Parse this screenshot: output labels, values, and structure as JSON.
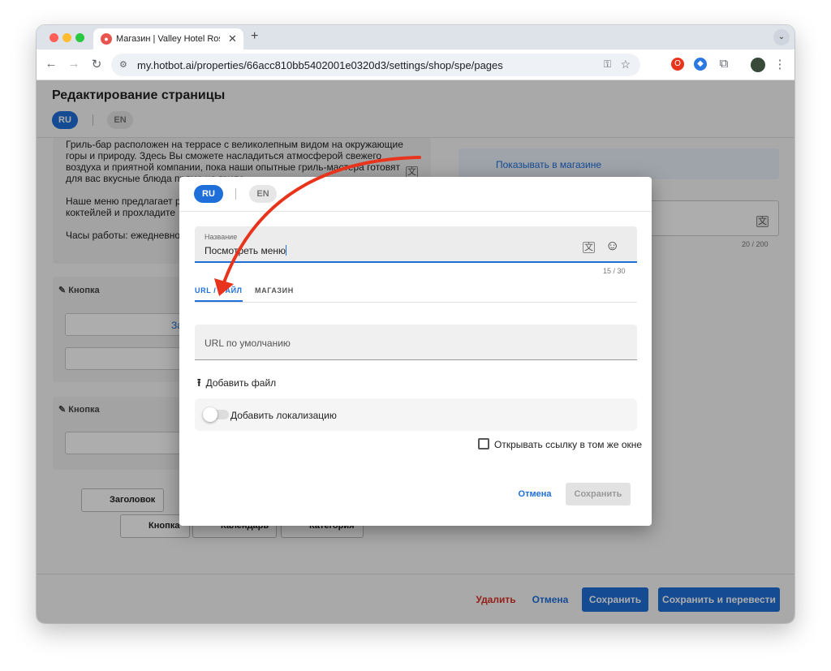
{
  "browser": {
    "tab_title": "Магазин | Valley Hotel Rosa Khutor",
    "tab_close": "✕",
    "new_tab": "+",
    "url": "my.hotbot.ai/properties/66acc810bb5402001e0320d3/settings/shop/spe/pages"
  },
  "page": {
    "title": "Редактирование страницы",
    "lang_active": "RU",
    "lang_inactive": "EN",
    "description_p1": "Гриль-бар расположен на террасе с великолепным видом на окружающие горы и природу. Здесь Вы сможете насладиться атмосферой свежего воздуха и приятной компании, пока наши опытные гриль-мастера готовят для вас вкусные блюда прямо на гриле.",
    "description_p2": "Наше меню предлагает р морепродуктов, овощны Приятное дополнение к коктейлей и прохладите",
    "description_p3": "Часы работы: ежедневно",
    "section1_label": "Кнопка",
    "section1_field_text": "За",
    "section2_label": "Кнопка",
    "show_in_shop": "Показывать в магазине",
    "right_counter": "20 / 200",
    "blocks": {
      "heading": "Заголовок",
      "button": "Кнопка",
      "calendar": "Календарь",
      "category": "Категория"
    },
    "footer": {
      "delete": "Удалить",
      "cancel": "Отмена",
      "save": "Сохранить",
      "save_translate": "Сохранить и перевести"
    }
  },
  "dialog": {
    "lang_active": "RU",
    "lang_inactive": "EN",
    "name_label": "Название",
    "name_value": "Посмотреть меню",
    "name_counter": "15 / 30",
    "tabs": [
      "URL / ФАЙЛ",
      "МАГАЗИН"
    ],
    "url_placeholder": "URL по умолчанию",
    "add_file": "Добавить файл",
    "add_localization": "Добавить локализацию",
    "open_same_window": "Открывать ссылку в том же окне",
    "cancel": "Отмена",
    "save": "Сохранить"
  },
  "colors": {
    "accent": "#1e6fd9",
    "danger": "#d93025",
    "annotation_arrow": "#e8341c"
  }
}
